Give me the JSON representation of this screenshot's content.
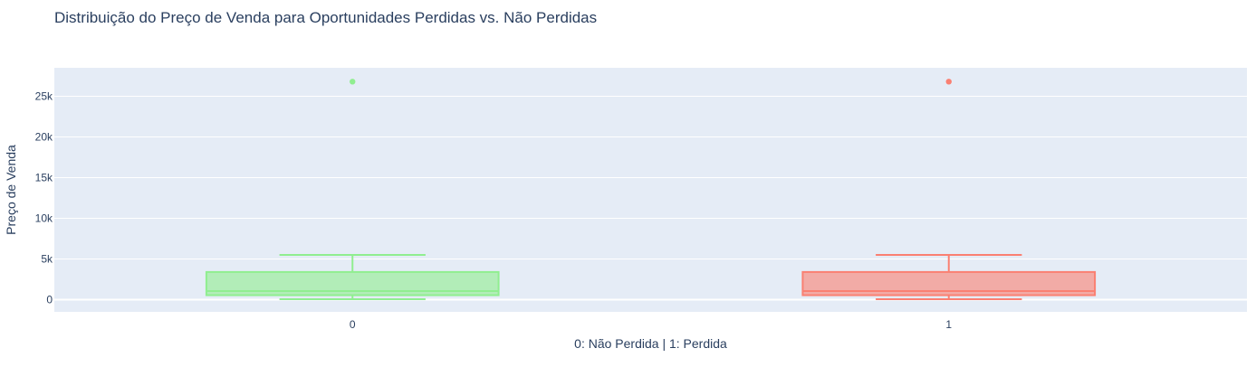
{
  "chart_data": {
    "type": "box",
    "title": "Distribuição do Preço de Venda para Oportunidades Perdidas vs. Não Perdidas",
    "xlabel": "0: Não Perdida | 1: Perdida",
    "ylabel": "Preço de Venda",
    "categories": [
      "0",
      "1"
    ],
    "y_ticks": [
      {
        "value": 0,
        "label": "0"
      },
      {
        "value": 5000,
        "label": "5k"
      },
      {
        "value": 10000,
        "label": "10k"
      },
      {
        "value": 15000,
        "label": "15k"
      },
      {
        "value": 20000,
        "label": "20k"
      },
      {
        "value": 25000,
        "label": "25k"
      }
    ],
    "ylim": [
      -1500,
      28500
    ],
    "grid": true,
    "series": [
      {
        "category": "0",
        "color": "#90ee90",
        "stats": {
          "lower_fence": 50,
          "q1": 550,
          "median": 1050,
          "q3": 3400,
          "upper_fence": 5500
        },
        "outliers": [
          26800
        ]
      },
      {
        "category": "1",
        "color": "#fa8072",
        "stats": {
          "lower_fence": 50,
          "q1": 550,
          "median": 1050,
          "q3": 3400,
          "upper_fence": 5500
        },
        "outliers": [
          26800
        ]
      }
    ]
  }
}
